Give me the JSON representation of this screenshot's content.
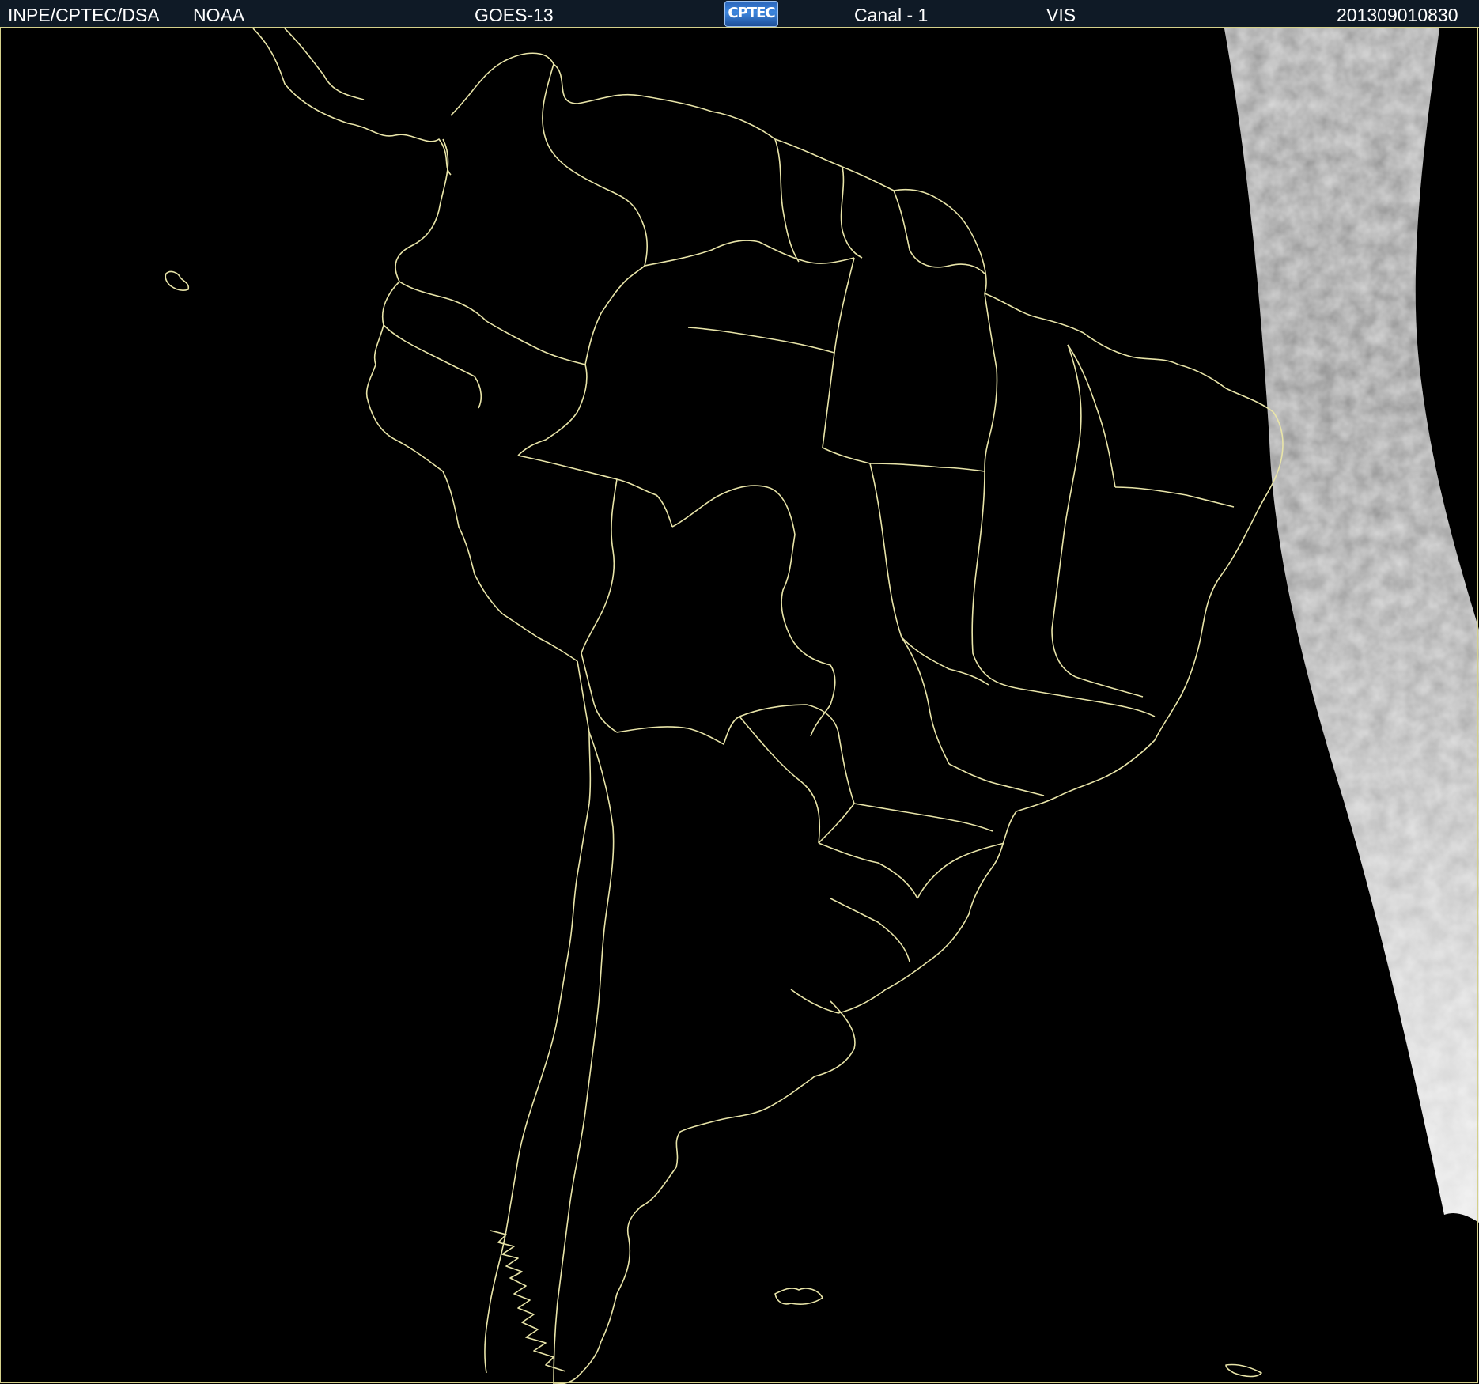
{
  "header": {
    "agency": "INPE/CPTEC/DSA",
    "source": "NOAA",
    "satellite": "GOES-13",
    "logo_text": "CPTEC",
    "channel": "Canal - 1",
    "band": "VIS",
    "timestamp": "201309010830"
  },
  "colors": {
    "background": "#000000",
    "header_bg": "#0f1a26",
    "border_lines": "#e8e4a8",
    "logo_blue": "#3c86de"
  },
  "icons": {
    "logo": "cptec-logo"
  }
}
